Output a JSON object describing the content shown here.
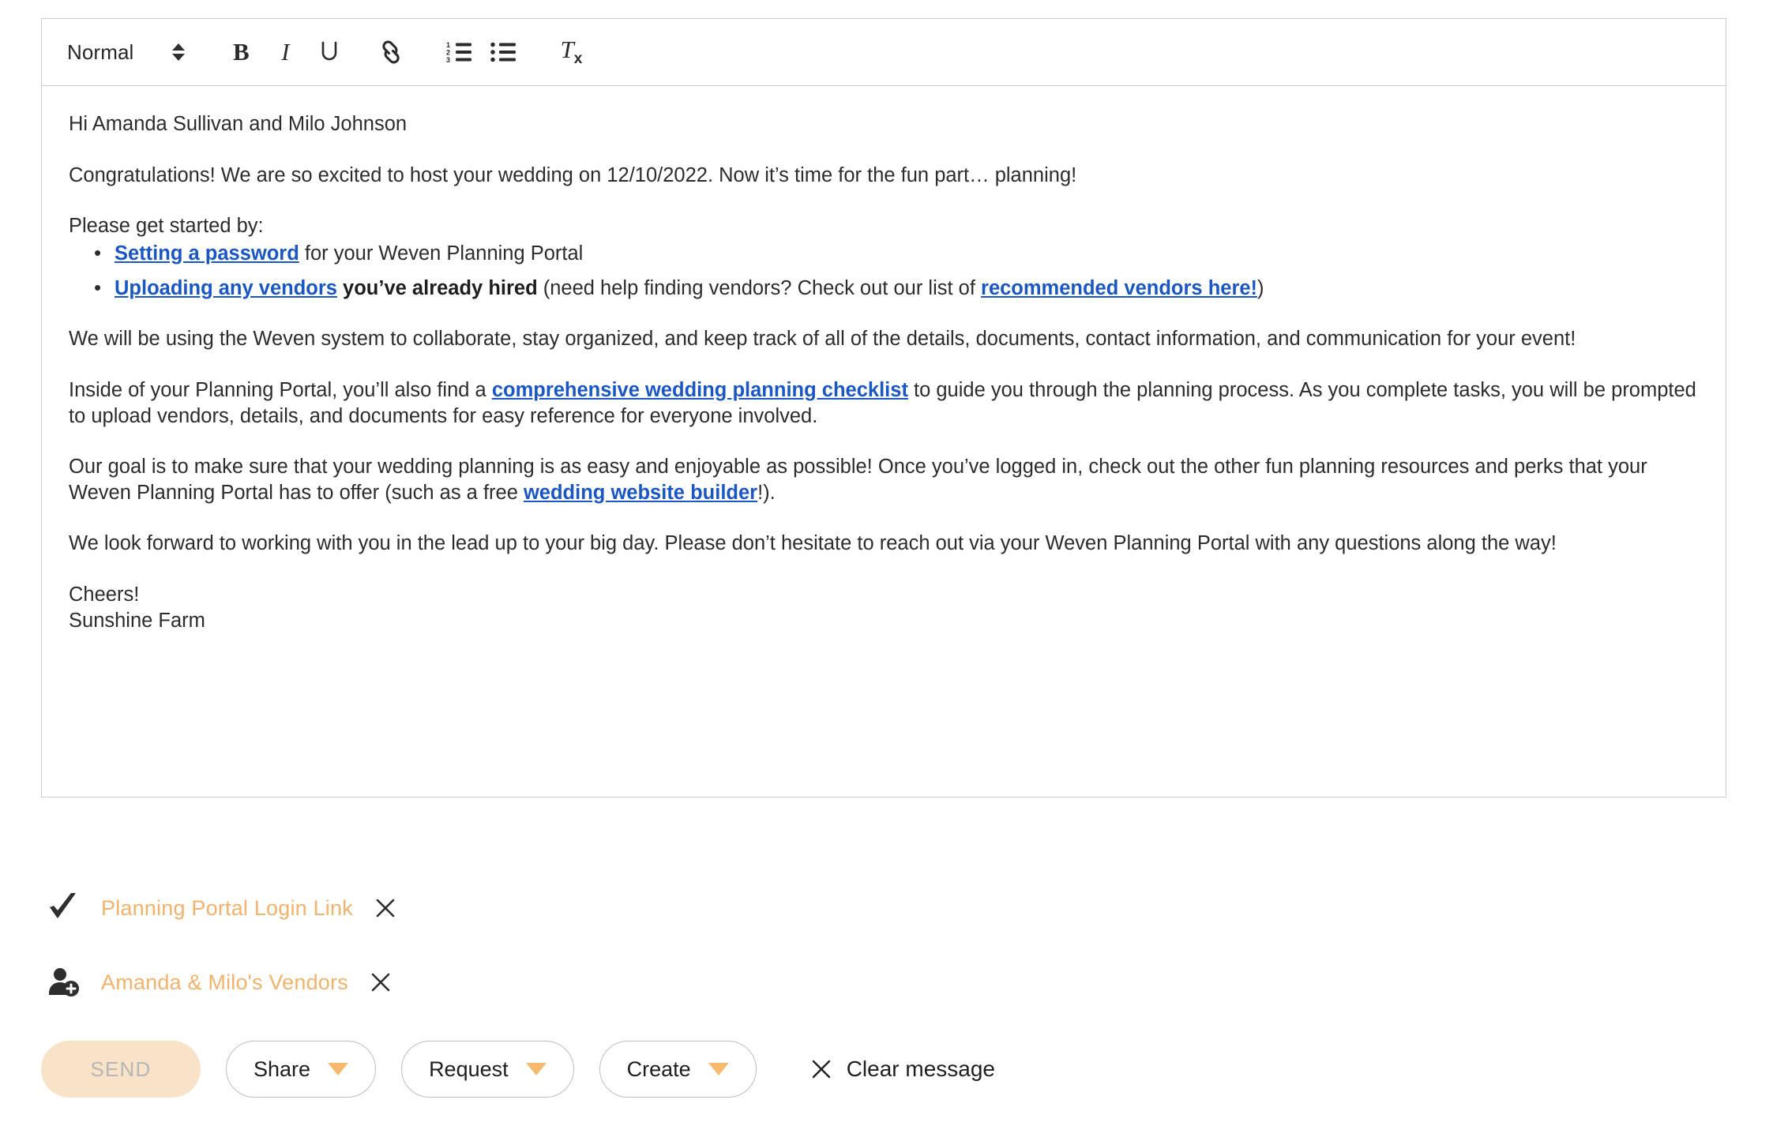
{
  "toolbar": {
    "format_label": "Normal",
    "items": [
      {
        "name": "format-select",
        "label": "Normal"
      },
      {
        "name": "bold-button",
        "label": "B"
      },
      {
        "name": "italic-button",
        "label": "I"
      },
      {
        "name": "underline-button",
        "label": "U"
      },
      {
        "name": "link-button",
        "label": "link-icon"
      },
      {
        "name": "ordered-list-button",
        "label": "ordered-list-icon"
      },
      {
        "name": "bullet-list-button",
        "label": "bullet-list-icon"
      },
      {
        "name": "clear-format-button",
        "label": "Tx"
      }
    ],
    "bold_glyph": "B",
    "italic_glyph": "I",
    "underline_glyph": "U",
    "clear_format_glyph": "T",
    "clear_format_sub": "x"
  },
  "message": {
    "greeting": "Hi Amanda Sullivan and Milo Johnson",
    "congrats": "Congratulations! We are so excited to host your wedding on 12/10/2022. Now it’s time for the fun part… planning!",
    "get_started": "Please get started by:",
    "bullets": [
      {
        "link": "Setting a password",
        "after": " for your Weven Planning Portal"
      },
      {
        "link": "Uploading any vendors",
        "bold_after": " you’ve already hired",
        "after": " (need help finding vendors? Check out our list of ",
        "link2": "recommended vendors here!",
        "tail": ")"
      }
    ],
    "para_system": "We will be using the Weven system to collaborate, stay organized, and keep track of all of the details, documents, contact information, and communication for your event!",
    "para_portal_before": "Inside of your Planning Portal, you’ll also find a ",
    "para_portal_link": "comprehensive wedding planning checklist",
    "para_portal_after": " to guide you through the planning process. As you complete tasks, you will be prompted to upload vendors, details, and documents for easy reference for everyone involved.",
    "para_goal_before": "Our goal is to make sure that your wedding planning is as easy and enjoyable as possible! Once you’ve logged in, check out the other fun planning resources and perks that your Weven Planning Portal has to offer (such as a free ",
    "para_goal_link": "wedding website builder",
    "para_goal_after": "!).",
    "para_closing": "We look forward to working with you in the lead up to your big day. Please don’t hesitate to reach out via your Weven Planning Portal with any questions along the way!",
    "signoff": "Cheers!",
    "signature": "Sunshine Farm"
  },
  "attachments": [
    {
      "icon": "checkmark-icon",
      "name": "Planning Portal Login Link",
      "remove": "✕"
    },
    {
      "icon": "person-add-icon",
      "name": "Amanda & Milo's Vendors",
      "remove": "✕"
    }
  ],
  "actions": {
    "send_label": "SEND",
    "share_label": "Share",
    "request_label": "Request",
    "create_label": "Create",
    "clear_label": "Clear message",
    "clear_icon": "✕"
  },
  "colors": {
    "link_blue": "#1a57c4",
    "accent_orange": "#f3b26b",
    "send_bg": "#f9e3c8",
    "send_text": "#b6b6b6",
    "border_gray": "#cccccc"
  }
}
